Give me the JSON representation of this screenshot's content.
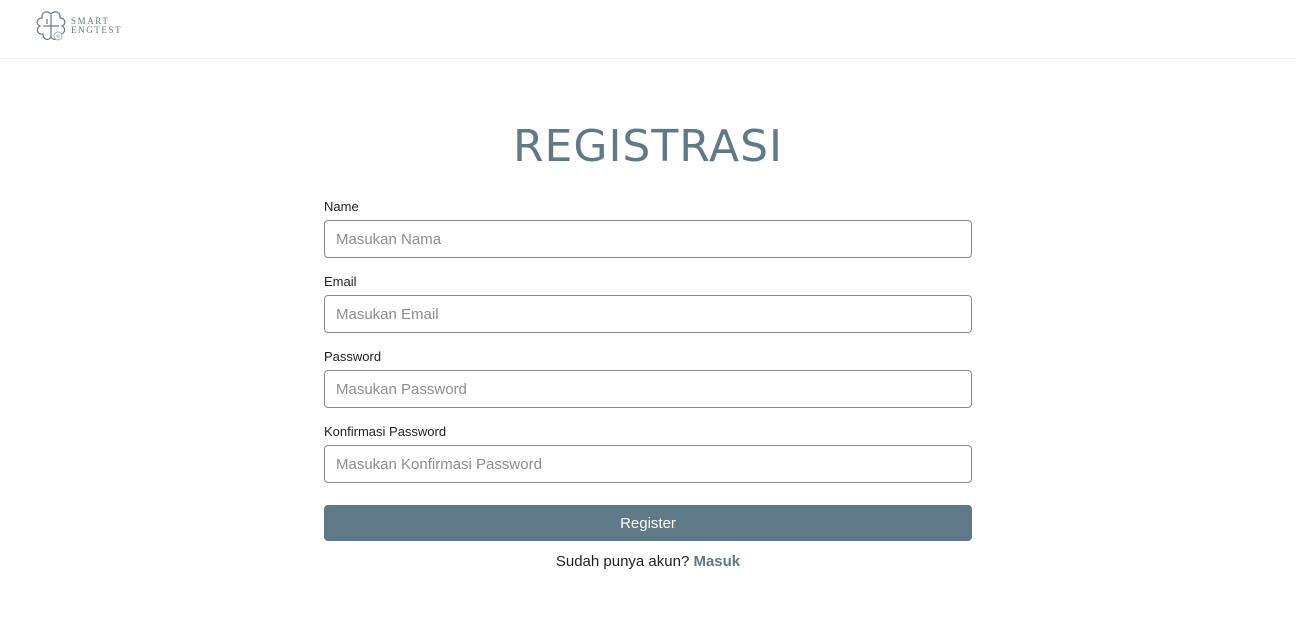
{
  "header": {
    "logo": {
      "line1": "SMART",
      "line2": "ENGTEST",
      "icon": "clover-book-logo-icon"
    }
  },
  "page": {
    "title": "REGISTRASI"
  },
  "form": {
    "name": {
      "label": "Name",
      "placeholder": "Masukan Nama",
      "value": ""
    },
    "email": {
      "label": "Email",
      "placeholder": "Masukan Email",
      "value": ""
    },
    "password": {
      "label": "Password",
      "placeholder": "Masukan Password",
      "value": ""
    },
    "confirm_password": {
      "label": "Konfirmasi Password",
      "placeholder": "Masukan Konfirmasi Password",
      "value": ""
    },
    "submit_label": "Register"
  },
  "footer_prompt": {
    "text": "Sudah punya akun? ",
    "link_label": "Masuk"
  },
  "colors": {
    "accent": "#5f7a86",
    "input_border": "#8a8a8a",
    "divider": "#eeeeee"
  }
}
